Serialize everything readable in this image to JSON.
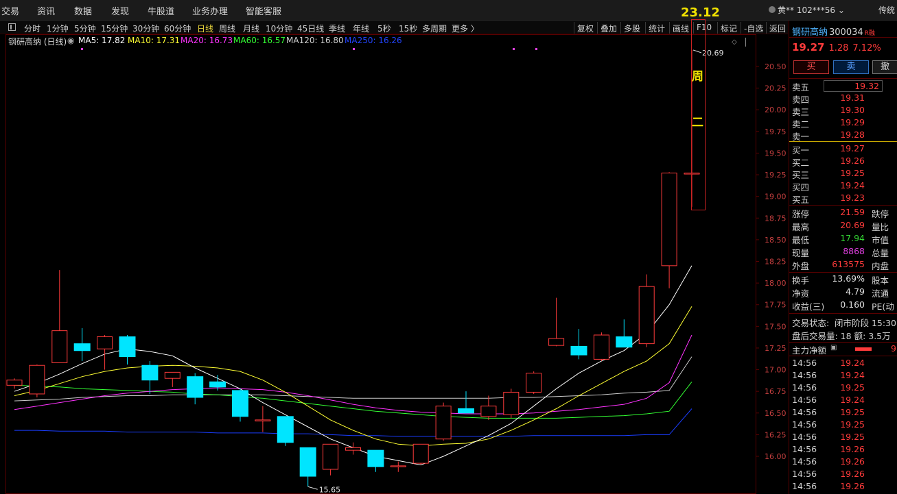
{
  "menu": [
    "交易",
    "资讯",
    "数据",
    "发现",
    "牛股道",
    "业务办理",
    "智能客服"
  ],
  "user": {
    "name": "黄**",
    "account": "102***56"
  },
  "traditional_label": "传统",
  "periods": [
    "分时",
    "1分钟",
    "5分钟",
    "15分钟",
    "30分钟",
    "60分钟",
    "日线",
    "周线",
    "月线",
    "10分钟",
    "45日线",
    "季线",
    "年线",
    "5秒",
    "15秒",
    "多周期",
    "更多 〉"
  ],
  "active_period": "日线",
  "tools": [
    "复权",
    "叠加",
    "多股",
    "统计",
    "画线",
    "F10",
    "标记",
    "-自选",
    "返回"
  ],
  "chart_title": "钢研高纳 (日线)",
  "ma_info": {
    "ma5": "MA5: 17.82",
    "ma10": "MA10: 17.31",
    "ma20": "MA20: 16.73",
    "ma60": "MA60: 16.57",
    "ma120": "MA120: 16.80",
    "ma250": "MA250: 16.26"
  },
  "colors": {
    "up": "#ff3b3b",
    "down": "#00e5ff",
    "ma5": "#ffffff",
    "ma10": "#ffff33",
    "ma20": "#ff33ff",
    "ma60": "#33ff33",
    "ma120": "#cccccc",
    "ma250": "#1a3dff"
  },
  "week_label": {
    "price": "23.12",
    "c1": "周",
    "c2": "二"
  },
  "max_label": "20.69",
  "min_label": "15.65",
  "chart_data": {
    "type": "candlestick",
    "ylim": [
      15.8,
      20.7
    ],
    "y_ticks": [
      "20.50",
      "20.25",
      "20.00",
      "19.75",
      "19.50",
      "19.25",
      "19.00",
      "18.75",
      "18.50",
      "18.25",
      "18.00",
      "17.75",
      "17.50",
      "17.25",
      "17.00",
      "16.75",
      "16.50",
      "16.25",
      "16.00"
    ],
    "candles": [
      [
        16.82,
        16.88,
        16.9,
        16.78
      ],
      [
        16.72,
        17.05,
        17.06,
        16.68
      ],
      [
        17.08,
        17.45,
        18.15,
        17.08
      ],
      [
        17.3,
        17.22,
        17.48,
        17.1
      ],
      [
        17.24,
        17.38,
        17.4,
        17.0
      ],
      [
        17.38,
        17.15,
        17.4,
        17.06
      ],
      [
        17.05,
        16.88,
        17.1,
        16.72
      ],
      [
        16.9,
        16.97,
        16.97,
        16.8
      ],
      [
        16.92,
        16.68,
        16.96,
        16.6
      ],
      [
        16.86,
        16.8,
        16.94,
        16.76
      ],
      [
        16.76,
        16.46,
        16.78,
        16.4
      ],
      [
        16.42,
        16.42,
        16.58,
        16.28
      ],
      [
        16.46,
        16.16,
        16.46,
        16.12
      ],
      [
        16.1,
        15.77,
        16.1,
        15.65
      ],
      [
        15.85,
        16.14,
        16.14,
        15.78
      ],
      [
        16.07,
        16.1,
        16.16,
        16.02
      ],
      [
        16.07,
        15.88,
        16.07,
        15.82
      ],
      [
        15.88,
        15.89,
        15.94,
        15.82
      ],
      [
        15.92,
        16.14,
        16.14,
        15.9
      ],
      [
        16.2,
        16.58,
        16.62,
        16.18
      ],
      [
        16.55,
        16.5,
        16.75,
        16.5
      ],
      [
        16.46,
        16.58,
        16.7,
        16.42
      ],
      [
        16.48,
        16.74,
        16.78,
        16.44
      ],
      [
        16.74,
        16.96,
        16.98,
        16.72
      ],
      [
        17.28,
        17.36,
        17.83,
        17.27
      ],
      [
        17.27,
        17.17,
        17.47,
        17.12
      ],
      [
        17.12,
        17.4,
        17.43,
        17.1
      ],
      [
        17.38,
        17.26,
        17.58,
        17.26
      ],
      [
        17.3,
        17.96,
        18.1,
        17.26
      ],
      [
        18.2,
        19.27,
        19.28,
        17.94
      ],
      [
        19.27,
        19.27,
        20.69,
        18.88
      ]
    ],
    "ma5": [
      16.75,
      16.84,
      16.95,
      17.07,
      17.18,
      17.24,
      17.21,
      17.16,
      17.02,
      16.9,
      16.78,
      16.62,
      16.48,
      16.34,
      16.2,
      16.1,
      16.0,
      15.95,
      15.9,
      16.0,
      16.12,
      16.24,
      16.38,
      16.58,
      16.78,
      16.96,
      17.1,
      17.22,
      17.42,
      17.75,
      18.2
    ],
    "ma10": [
      16.7,
      16.76,
      16.84,
      16.92,
      16.98,
      17.02,
      17.04,
      17.05,
      17.04,
      17.02,
      16.98,
      16.88,
      16.74,
      16.58,
      16.42,
      16.3,
      16.2,
      16.14,
      16.12,
      16.14,
      16.15,
      16.2,
      16.3,
      16.42,
      16.55,
      16.7,
      16.84,
      16.98,
      17.1,
      17.3,
      17.73
    ],
    "ma20": [
      16.54,
      16.58,
      16.62,
      16.66,
      16.7,
      16.73,
      16.75,
      16.77,
      16.78,
      16.79,
      16.78,
      16.77,
      16.74,
      16.7,
      16.65,
      16.6,
      16.56,
      16.53,
      16.51,
      16.5,
      16.49,
      16.49,
      16.49,
      16.5,
      16.52,
      16.54,
      16.57,
      16.6,
      16.67,
      16.85,
      17.4
    ],
    "ma60": [
      16.82,
      16.81,
      16.8,
      16.78,
      16.77,
      16.76,
      16.75,
      16.74,
      16.72,
      16.71,
      16.69,
      16.67,
      16.64,
      16.61,
      16.58,
      16.55,
      16.52,
      16.5,
      16.48,
      16.46,
      16.45,
      16.44,
      16.44,
      16.44,
      16.44,
      16.45,
      16.46,
      16.47,
      16.49,
      16.52,
      16.86
    ],
    "ma120": [
      16.64,
      16.65,
      16.66,
      16.68,
      16.69,
      16.7,
      16.7,
      16.71,
      16.71,
      16.71,
      16.71,
      16.71,
      16.7,
      16.69,
      16.68,
      16.67,
      16.67,
      16.67,
      16.67,
      16.67,
      16.67,
      16.67,
      16.68,
      16.68,
      16.69,
      16.7,
      16.71,
      16.73,
      16.74,
      16.76,
      17.15
    ],
    "ma250": [
      16.3,
      16.3,
      16.29,
      16.29,
      16.29,
      16.28,
      16.28,
      16.28,
      16.28,
      16.27,
      16.27,
      16.27,
      16.26,
      16.26,
      16.25,
      16.24,
      16.24,
      16.23,
      16.23,
      16.23,
      16.23,
      16.23,
      16.23,
      16.24,
      16.24,
      16.24,
      16.24,
      16.24,
      16.25,
      16.25,
      16.55
    ]
  },
  "quote": {
    "name": "钢研高纳",
    "code": "300034",
    "tag": "R融",
    "price": "19.27",
    "change": "1.28",
    "pct": "7.12%",
    "buy_label": "买",
    "sell_label": "卖",
    "cancel_label": "撤",
    "asks": [
      {
        "label": "卖五",
        "price": "19.32"
      },
      {
        "label": "卖四",
        "price": "19.31"
      },
      {
        "label": "卖三",
        "price": "19.30"
      },
      {
        "label": "卖二",
        "price": "19.29"
      },
      {
        "label": "卖一",
        "price": "19.28"
      }
    ],
    "bids": [
      {
        "label": "买一",
        "price": "19.27"
      },
      {
        "label": "买二",
        "price": "19.26"
      },
      {
        "label": "买三",
        "price": "19.25"
      },
      {
        "label": "买四",
        "price": "19.24"
      },
      {
        "label": "买五",
        "price": "19.23"
      }
    ],
    "stats1": [
      {
        "l": "涨停",
        "v": "21.59",
        "r": "跌停",
        "c": "red"
      },
      {
        "l": "最高",
        "v": "20.69",
        "r": "量比",
        "c": "red"
      },
      {
        "l": "最低",
        "v": "17.94",
        "r": "市值",
        "c": "green"
      },
      {
        "l": "现量",
        "v": "8868",
        "r": "总量",
        "c": "mag"
      },
      {
        "l": "外盘",
        "v": "613575",
        "r": "内盘",
        "c": "red"
      }
    ],
    "stats2": [
      {
        "l": "换手",
        "v": "13.69%",
        "r": "股本",
        "c": "wht"
      },
      {
        "l": "净资",
        "v": "4.79",
        "r": "流通",
        "c": "wht"
      },
      {
        "l": "收益(三)",
        "v": "0.160",
        "r": "PE(动",
        "c": "wht"
      }
    ],
    "trade_status_label": "交易状态:",
    "trade_status": "闭市阶段 15:30",
    "after_hours": "盘后交易量: 18  额: 3.5万",
    "main_flow_label": "主力净额",
    "main_flow_value": "9",
    "ticks": [
      {
        "t": "14:56",
        "p": "19.24"
      },
      {
        "t": "14:56",
        "p": "19.24"
      },
      {
        "t": "14:56",
        "p": "19.25"
      },
      {
        "t": "14:56",
        "p": "19.24"
      },
      {
        "t": "14:56",
        "p": "19.25"
      },
      {
        "t": "14:56",
        "p": "19.25"
      },
      {
        "t": "14:56",
        "p": "19.25"
      },
      {
        "t": "14:56",
        "p": "19.26"
      },
      {
        "t": "14:56",
        "p": "19.26"
      },
      {
        "t": "14:56",
        "p": "19.26"
      },
      {
        "t": "14:56",
        "p": "19.26"
      }
    ]
  }
}
